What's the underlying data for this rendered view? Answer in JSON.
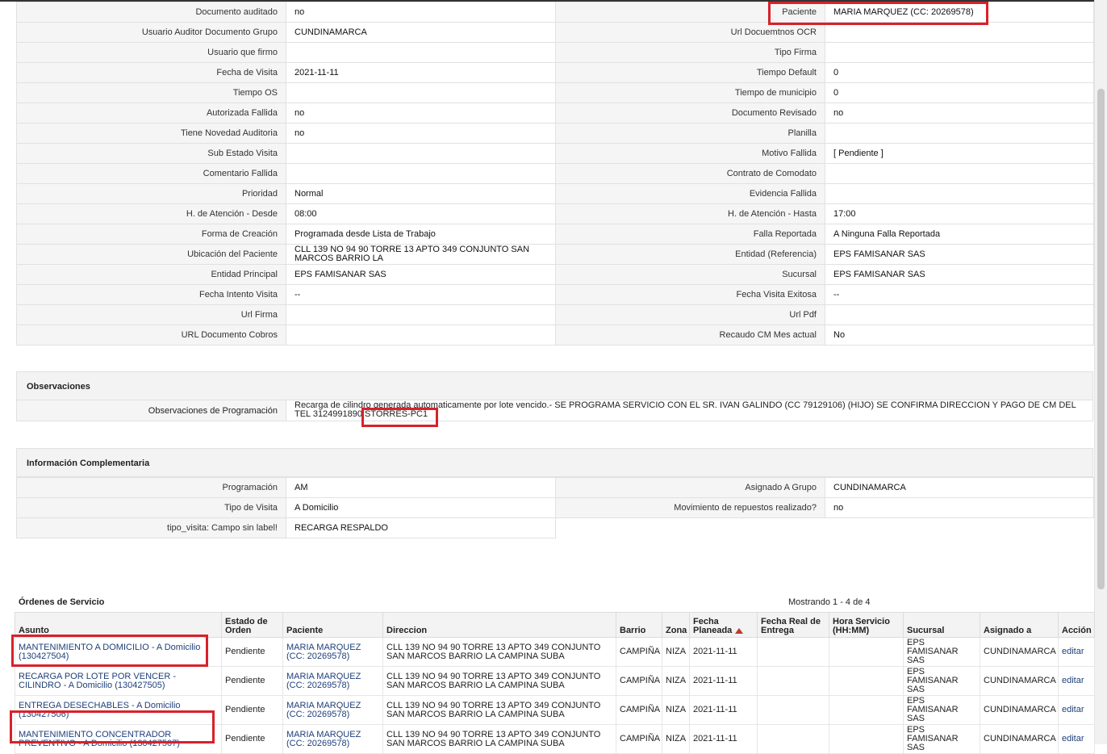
{
  "left_rows": [
    {
      "label": "Documento auditado",
      "value": "no"
    },
    {
      "label": "Usuario Auditor Documento Grupo",
      "value": "CUNDINAMARCA"
    },
    {
      "label": "Usuario que firmo",
      "value": ""
    },
    {
      "label": "Fecha de Visita",
      "value": "2021-11-11"
    },
    {
      "label": "Tiempo OS",
      "value": ""
    },
    {
      "label": "Autorizada Fallida",
      "value": "no"
    },
    {
      "label": "Tiene Novedad Auditoria",
      "value": "no"
    },
    {
      "label": "Sub Estado Visita",
      "value": ""
    },
    {
      "label": "Comentario Fallida",
      "value": ""
    },
    {
      "label": "Prioridad",
      "value": "Normal"
    },
    {
      "label": "H. de Atención - Desde",
      "value": "08:00"
    },
    {
      "label": "Forma de Creación",
      "value": "Programada desde Lista de Trabajo"
    },
    {
      "label": "Ubicación del Paciente",
      "value": "CLL 139 NO 94 90 TORRE 13 APTO 349 CONJUNTO SAN MARCOS BARRIO LA"
    },
    {
      "label": "Entidad Principal",
      "value": "EPS FAMISANAR SAS"
    },
    {
      "label": "Fecha Intento Visita",
      "value": "--"
    },
    {
      "label": "Url Firma",
      "value": ""
    },
    {
      "label": "URL Documento Cobros",
      "value": ""
    }
  ],
  "right_rows": [
    {
      "label": "Paciente",
      "value": "MARIA MARQUEZ (CC: 20269578)"
    },
    {
      "label": "Url Docuemtnos OCR",
      "value": ""
    },
    {
      "label": "Tipo Firma",
      "value": ""
    },
    {
      "label": "Tiempo Default",
      "value": "0"
    },
    {
      "label": "Tiempo de municipio",
      "value": "0"
    },
    {
      "label": "Documento Revisado",
      "value": "no"
    },
    {
      "label": "Planilla",
      "value": ""
    },
    {
      "label": "Motivo Fallida",
      "value": "[ Pendiente ]"
    },
    {
      "label": "Contrato de Comodato",
      "value": ""
    },
    {
      "label": "Evidencia Fallida",
      "value": ""
    },
    {
      "label": "H. de Atención - Hasta",
      "value": "17:00"
    },
    {
      "label": "Falla Reportada",
      "value": "A Ninguna Falla Reportada"
    },
    {
      "label": "Entidad (Referencia)",
      "value": "EPS FAMISANAR SAS"
    },
    {
      "label": "Sucursal",
      "value": "EPS FAMISANAR SAS"
    },
    {
      "label": "Fecha Visita Exitosa",
      "value": "--"
    },
    {
      "label": "Url Pdf",
      "value": ""
    },
    {
      "label": "Recaudo CM Mes actual",
      "value": "No"
    }
  ],
  "observaciones": {
    "title": "Observaciones",
    "label": "Observaciones de Programación",
    "value": "Recarga de cilindro generada automaticamente por lote vencido.- SE PROGRAMA SERVICIO CON EL SR. IVAN GALINDO (CC 79129106) (HIJO) SE CONFIRMA DIRECCION Y PAGO DE CM DEL TEL 3124991890 STORRES-PC1"
  },
  "complementaria": {
    "title": "Información Complementaria",
    "rows": [
      {
        "l1": "Programación",
        "v1": "AM",
        "l2": "Asignado A Grupo",
        "v2": "CUNDINAMARCA"
      },
      {
        "l1": "Tipo de Visita",
        "v1": "A Domicilio",
        "l2": "Movimiento de repuestos realizado?",
        "v2": "no"
      },
      {
        "l1": "tipo_visita: Campo sin label!",
        "v1": "RECARGA RESPALDO",
        "l2": "",
        "v2": ""
      }
    ]
  },
  "orders": {
    "title": "Órdenes de Servicio",
    "count": "Mostrando 1 - 4 de 4",
    "headers": [
      "Asunto",
      "Estado de Orden",
      "Paciente",
      "Direccion",
      "Barrio",
      "Zona",
      "Fecha Planeada",
      "Fecha Real de Entrega",
      "Hora Servicio (HH:MM)",
      "Sucursal",
      "Asignado a",
      "Acción"
    ],
    "rows": [
      [
        "MANTENIMIENTO A DOMICILIO - A Domicilio (130427504)",
        "Pendiente",
        "MARIA MARQUEZ (CC: 20269578)",
        "CLL 139 NO 94 90 TORRE 13 APTO 349 CONJUNTO SAN MARCOS BARRIO LA CAMPINA SUBA",
        "CAMPIÑA",
        "NIZA",
        "2021-11-11",
        "",
        "",
        "EPS FAMISANAR SAS",
        "CUNDINAMARCA",
        "editar"
      ],
      [
        "RECARGA POR LOTE POR VENCER - CILINDRO - A Domicilio (130427505)",
        "Pendiente",
        "MARIA MARQUEZ (CC: 20269578)",
        "CLL 139 NO 94 90 TORRE 13 APTO 349 CONJUNTO SAN MARCOS BARRIO LA CAMPINA SUBA",
        "CAMPIÑA",
        "NIZA",
        "2021-11-11",
        "",
        "",
        "EPS FAMISANAR SAS",
        "CUNDINAMARCA",
        "editar"
      ],
      [
        "ENTREGA DESECHABLES - A Domicilio (130427506)",
        "Pendiente",
        "MARIA MARQUEZ (CC: 20269578)",
        "CLL 139 NO 94 90 TORRE 13 APTO 349 CONJUNTO SAN MARCOS BARRIO LA CAMPINA SUBA",
        "CAMPIÑA",
        "NIZA",
        "2021-11-11",
        "",
        "",
        "EPS FAMISANAR SAS",
        "CUNDINAMARCA",
        "editar"
      ],
      [
        "MANTENIMIENTO CONCENTRADOR PREVENTIVO - A Domicilio (130427507)",
        "Pendiente",
        "MARIA MARQUEZ (CC: 20269578)",
        "CLL 139 NO 94 90 TORRE 13 APTO 349 CONJUNTO SAN MARCOS BARRIO LA CAMPINA SUBA",
        "CAMPIÑA",
        "NIZA",
        "2021-11-11",
        "",
        "",
        "EPS FAMISANAR SAS",
        "CUNDINAMARCA",
        "editar"
      ]
    ]
  },
  "colors": {
    "highlight": "#d8212a",
    "link": "#1e3f7a",
    "sort_arrow": "#c0392b"
  }
}
